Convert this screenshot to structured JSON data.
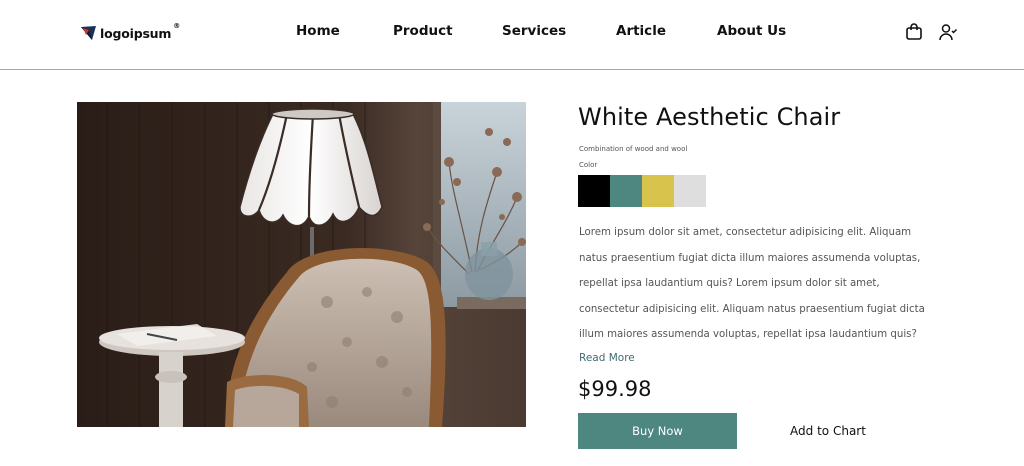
{
  "header": {
    "logo_text": "logoipsum",
    "logo_mark": "®",
    "nav": [
      {
        "label": "Home"
      },
      {
        "label": "Product"
      },
      {
        "label": "Services"
      },
      {
        "label": "Article"
      },
      {
        "label": "About Us"
      }
    ],
    "icons": [
      "shopping-bag-icon",
      "user-add-icon"
    ]
  },
  "product": {
    "title": "White Aesthetic Chair",
    "subtitle": "Combination of wood and wool",
    "color_label": "Color",
    "swatches": [
      {
        "name": "black",
        "hex": "#000000"
      },
      {
        "name": "teal",
        "hex": "#4e8680"
      },
      {
        "name": "mustard",
        "hex": "#d8c44c"
      },
      {
        "name": "light-gray",
        "hex": "#dedede"
      }
    ],
    "description_lines": [
      "Lorem ipsum dolor sit amet, consectetur adipisicing elit. Aliquam",
      "natus praesentium fugiat dicta illum maiores assumenda voluptas,",
      "repellat ipsa laudantium quis? Lorem ipsum dolor sit amet,",
      "consectetur adipisicing elit. Aliquam natus praesentium fugiat dicta",
      "illum maiores assumenda voluptas, repellat ipsa laudantium quis?"
    ],
    "read_more": "Read More",
    "price": "$99.98",
    "buy_label": "Buy Now",
    "add_label": "Add to Chart"
  },
  "colors": {
    "accent": "#4e8680",
    "link": "#3f6b72",
    "divider": "#a9a9a9"
  }
}
